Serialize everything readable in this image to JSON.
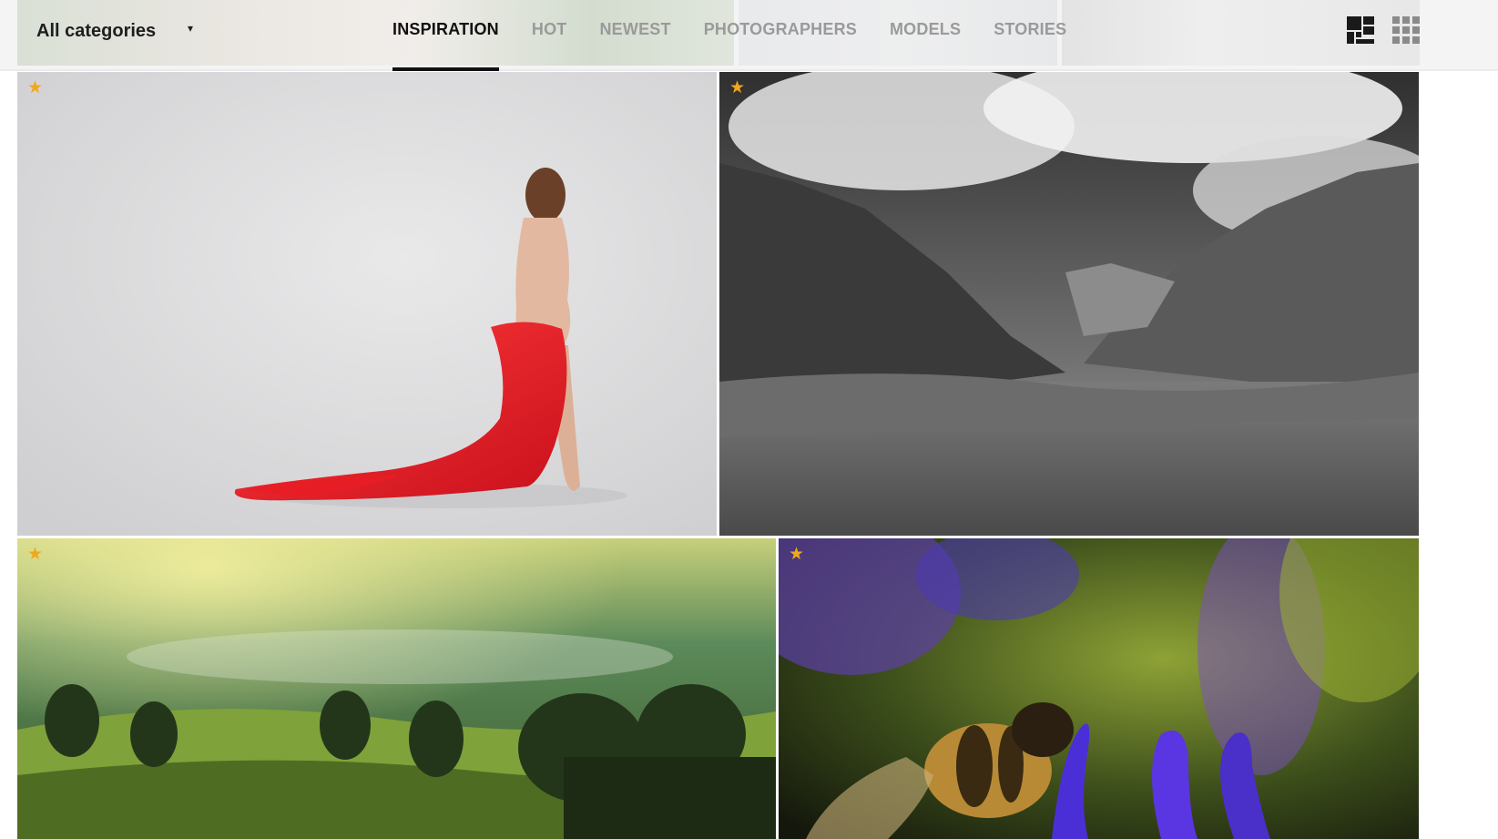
{
  "header": {
    "category_select": {
      "value": "All categories",
      "caret": "▾"
    },
    "tabs": [
      {
        "label": "INSPIRATION",
        "active": true
      },
      {
        "label": "HOT",
        "active": false
      },
      {
        "label": "NEWEST",
        "active": false
      },
      {
        "label": "PHOTOGRAPHERS",
        "active": false
      },
      {
        "label": "MODELS",
        "active": false
      },
      {
        "label": "STORIES",
        "active": false
      }
    ],
    "view_toggles": [
      {
        "icon": "mosaic-view-icon",
        "selected": true
      },
      {
        "icon": "grid-view-icon",
        "selected": false
      }
    ]
  },
  "gallery": {
    "featured_star": "★",
    "star_color": "#f0a81c",
    "photos": [
      {
        "subject": "woman-red-fabric-studio",
        "featured": true
      },
      {
        "subject": "black-white-mountain-valley",
        "featured": true
      },
      {
        "subject": "misty-green-hills-forest",
        "featured": true
      },
      {
        "subject": "bee-on-purple-flower-macro",
        "featured": true
      }
    ]
  },
  "colors": {
    "active_tab": "#111111",
    "inactive_tab": "#9a9a9a",
    "topbar_bg": "#f4f4f4"
  }
}
